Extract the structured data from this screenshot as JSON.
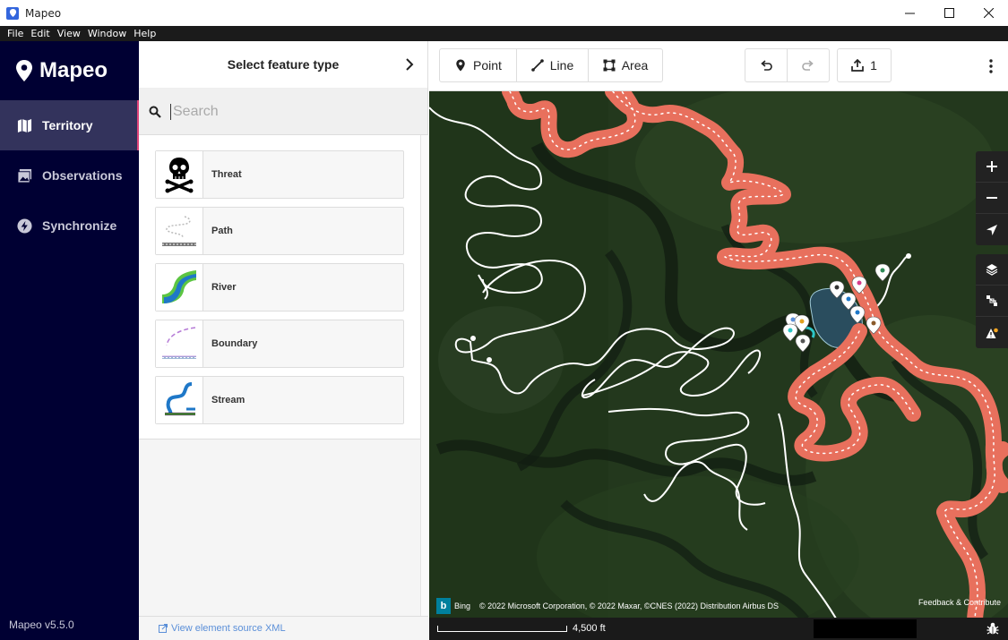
{
  "window": {
    "title": "Mapeo"
  },
  "menu": [
    "File",
    "Edit",
    "View",
    "Window",
    "Help"
  ],
  "sidebar": {
    "brand": "Mapeo",
    "items": [
      {
        "label": "Territory",
        "icon": "map-icon",
        "active": true
      },
      {
        "label": "Observations",
        "icon": "photo-icon",
        "active": false
      },
      {
        "label": "Synchronize",
        "icon": "lightning-icon",
        "active": false
      }
    ],
    "version": "Mapeo v5.5.0"
  },
  "panel": {
    "title": "Select feature type",
    "search_placeholder": "Search",
    "features": [
      {
        "label": "Threat",
        "icon": "skull-crossbones-icon"
      },
      {
        "label": "Path",
        "icon": "path-icon"
      },
      {
        "label": "River",
        "icon": "river-icon"
      },
      {
        "label": "Boundary",
        "icon": "boundary-icon"
      },
      {
        "label": "Stream",
        "icon": "stream-icon"
      }
    ],
    "footer_link": "View element source XML"
  },
  "toolbar": {
    "point_label": "Point",
    "line_label": "Line",
    "area_label": "Area",
    "upload_count": "1"
  },
  "map": {
    "attribution_brand": "Bing",
    "attribution": "© 2022 Microsoft Corporation, © 2022 Maxar, ©CNES (2022) Distribution Airbus DS",
    "feedback": "Feedback & Contribute",
    "scale": "4,500 ft",
    "colors": {
      "boundary": "#e8705d",
      "route": "#ffffff",
      "water": "#2a4d5e"
    }
  }
}
